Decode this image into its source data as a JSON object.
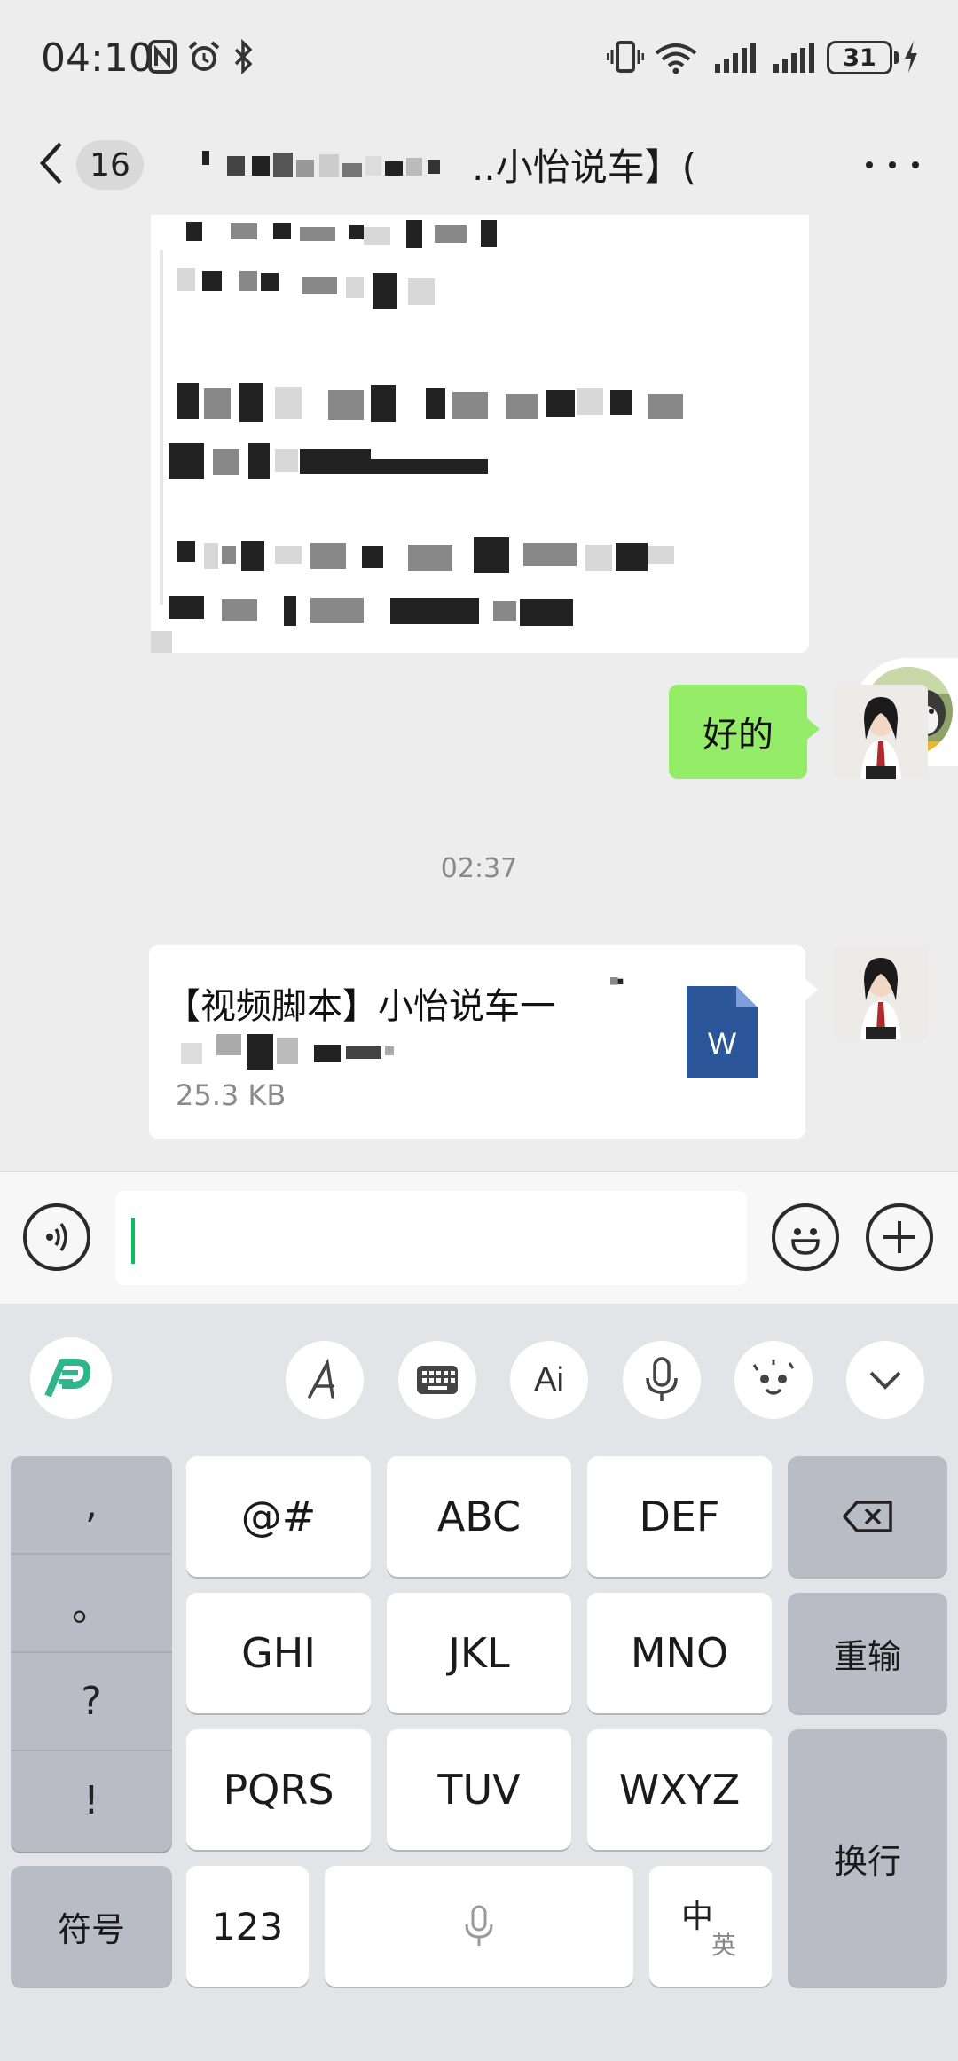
{
  "status_bar": {
    "time": "04:10",
    "battery": "31",
    "icons": [
      "nfc-icon",
      "alarm-icon",
      "bluetooth-icon",
      "vibrate-icon",
      "wifi-icon",
      "signal-icon",
      "signal-icon",
      "charging-icon"
    ]
  },
  "header": {
    "unread_count": "16",
    "title": "..小怡说车】(",
    "more_icon": "more-icon"
  },
  "messages": {
    "sent_text": "好的",
    "timestamp": "02:37",
    "file": {
      "name": "【视频脚本】小怡说车一",
      "size": "25.3 KB",
      "icon_letter": "W",
      "icon_color": "#2b579a"
    }
  },
  "input_bar": {
    "voice_icon": "voice-icon",
    "emoji_icon": "emoji-icon",
    "plus_icon": "plus-icon",
    "value": ""
  },
  "keyboard": {
    "toolbar": [
      "font-icon",
      "keyboard-icon",
      "ai-icon",
      "microphone-icon",
      "emoticon-icon",
      "collapse-icon"
    ],
    "toolbar_ai_label": "Ai",
    "punctuation": [
      ",",
      "。",
      "?",
      "!"
    ],
    "row1": [
      "@#",
      "ABC",
      "DEF"
    ],
    "row2": [
      "GHI",
      "JKL",
      "MNO"
    ],
    "row3": [
      "PQRS",
      "TUV",
      "WXYZ"
    ],
    "reenter": "重输",
    "newline": "换行",
    "symbols": "符号",
    "numbers": "123",
    "zh": "中",
    "en": "英"
  },
  "colors": {
    "background": "#ededed",
    "bubble_green": "#95ec69",
    "caret": "#07c160",
    "keyboard_bg": "#e3e4e8",
    "key_gray": "#b9bcc5",
    "logo_green": "#2fb58a"
  }
}
